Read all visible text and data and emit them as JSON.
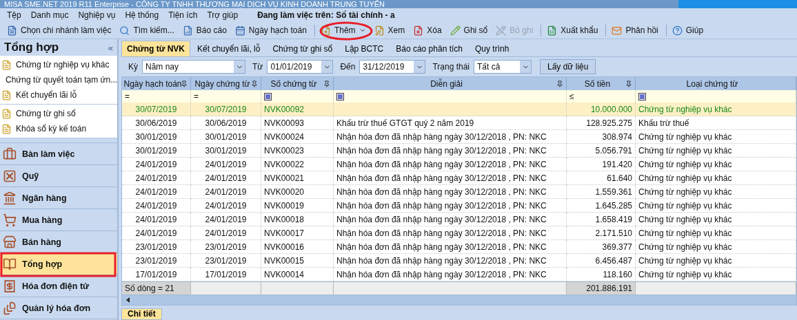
{
  "window": {
    "title": "MISA SME.NET 2019 R11 Enterprise - CÔNG TY TNHH THƯƠNG MẠI DỊCH VỤ KINH DOANH TRUNG TUYẾN"
  },
  "menu": {
    "items": [
      "Tệp",
      "Danh mục",
      "Nghiệp vụ",
      "Hệ thống",
      "Tiện ích",
      "Trợ giúp"
    ],
    "status": "Đang làm việc trên: Sổ tài chính - a"
  },
  "toolbar": [
    {
      "label": "Chọn chi nhánh làm việc",
      "disabled": false,
      "dropdown": false,
      "separator_before": false
    },
    {
      "label": "Tìm kiếm...",
      "disabled": false,
      "dropdown": false,
      "separator_before": false
    },
    {
      "label": "Báo cáo",
      "disabled": false,
      "dropdown": false,
      "separator_before": false
    },
    {
      "label": "Ngày hạch toán",
      "disabled": false,
      "dropdown": false,
      "separator_before": false
    },
    {
      "label": "Thêm",
      "disabled": false,
      "dropdown": true,
      "separator_before": true
    },
    {
      "label": "Xem",
      "disabled": false,
      "dropdown": false,
      "separator_before": false
    },
    {
      "label": "Xóa",
      "disabled": false,
      "dropdown": false,
      "separator_before": false
    },
    {
      "label": "Ghi sổ",
      "disabled": false,
      "dropdown": false,
      "separator_before": false
    },
    {
      "label": "Bỏ ghi",
      "disabled": true,
      "dropdown": false,
      "separator_before": false
    },
    {
      "label": "Xuất khẩu",
      "disabled": false,
      "dropdown": false,
      "separator_before": true
    },
    {
      "label": "Phản hồi",
      "disabled": false,
      "dropdown": false,
      "separator_before": true
    },
    {
      "label": "Giúp",
      "disabled": false,
      "dropdown": false,
      "separator_before": true
    }
  ],
  "sidebar": {
    "title": "Tổng hợp",
    "collapse": "«",
    "groups": [
      {
        "items": [
          "Chứng từ nghiệp vụ khác",
          "Chứng từ quyết toán tạm ứn...",
          "Kết chuyển lãi lỗ"
        ]
      },
      {
        "items": [
          "Chứng từ ghi sổ",
          "Khóa sổ kỳ kế toán"
        ]
      }
    ],
    "modules": [
      {
        "label": "Bàn làm việc",
        "selected": false
      },
      {
        "label": "Quỹ",
        "selected": false
      },
      {
        "label": "Ngân hàng",
        "selected": false
      },
      {
        "label": "Mua hàng",
        "selected": false
      },
      {
        "label": "Bán hàng",
        "selected": false
      },
      {
        "label": "Tổng hợp",
        "selected": true
      },
      {
        "label": "Hóa đơn điện tử",
        "selected": false
      },
      {
        "label": "Quản lý hóa đơn",
        "selected": false
      }
    ]
  },
  "tabs": [
    {
      "label": "Chứng từ NVK",
      "selected": true
    },
    {
      "label": "Kết chuyển lãi, lỗ",
      "selected": false
    },
    {
      "label": "Chứng từ ghi sổ",
      "selected": false
    },
    {
      "label": "Lập BCTC",
      "selected": false
    },
    {
      "label": "Báo cáo phân tích",
      "selected": false
    },
    {
      "label": "Quy trình",
      "selected": false
    }
  ],
  "filters": {
    "period_label": "Kỳ",
    "period": "Năm nay",
    "from_label": "Từ",
    "from": "01/01/2019",
    "to_label": "Đến",
    "to": "31/12/2019",
    "status_label": "Trạng thái",
    "status": "Tất cả",
    "fetch_button": "Lấy dữ liệu"
  },
  "table": {
    "columns": [
      {
        "label": "Ngày hạch toán",
        "pinned": true,
        "filter": {
          "kind": "operator",
          "text": "="
        }
      },
      {
        "label": "Ngày chứng từ",
        "pinned": true,
        "filter": {
          "kind": "operator",
          "text": "="
        }
      },
      {
        "label": "Số chứng từ",
        "pinned": true,
        "filter": {
          "kind": "checkbox"
        }
      },
      {
        "label": "Diễn giải",
        "pinned": true,
        "filter": {
          "kind": "checkbox"
        }
      },
      {
        "label": "Số tiền",
        "pinned": true,
        "filter": {
          "kind": "operator",
          "text": "≤"
        }
      },
      {
        "label": "Loại chứng từ",
        "pinned": false,
        "filter": {
          "kind": "checkbox"
        }
      }
    ],
    "rows": [
      {
        "selected": true,
        "cells": [
          "30/07/2019",
          "30/07/2019",
          "NVK00092",
          "",
          "10.000.000",
          "Chứng từ nghiệp vụ khác"
        ]
      },
      {
        "selected": false,
        "cells": [
          "30/06/2019",
          "30/06/2019",
          "NVK00093",
          "Khấu trừ thuế GTGT quý 2 năm 2019",
          "128.925.275",
          "Khấu trừ thuế"
        ]
      },
      {
        "selected": false,
        "cells": [
          "30/01/2019",
          "30/01/2019",
          "NVK00024",
          "Nhận hóa đơn đã nhập hàng ngày 30/12/2018 , PN: NKC",
          "308.974",
          "Chứng từ nghiệp vụ khác"
        ]
      },
      {
        "selected": false,
        "cells": [
          "30/01/2019",
          "30/01/2019",
          "NVK00023",
          "Nhận hóa đơn đã nhập hàng ngày 30/12/2018 , PN: NKC",
          "5.056.791",
          "Chứng từ nghiệp vụ khác"
        ]
      },
      {
        "selected": false,
        "cells": [
          "24/01/2019",
          "24/01/2019",
          "NVK00022",
          "Nhận hóa đơn đã nhập hàng ngày 30/12/2018 , PN: NKC",
          "191.420",
          "Chứng từ nghiệp vụ khác"
        ]
      },
      {
        "selected": false,
        "cells": [
          "24/01/2019",
          "24/01/2019",
          "NVK00021",
          "Nhận hóa đơn đã nhập hàng ngày 30/12/2018 , PN: NKC",
          "61.640",
          "Chứng từ nghiệp vụ khác"
        ]
      },
      {
        "selected": false,
        "cells": [
          "24/01/2019",
          "24/01/2019",
          "NVK00020",
          "Nhận hóa đơn đã nhập hàng ngày 30/12/2018 , PN: NKC",
          "1.559.361",
          "Chứng từ nghiệp vụ khác"
        ]
      },
      {
        "selected": false,
        "cells": [
          "24/01/2019",
          "24/01/2019",
          "NVK00019",
          "Nhận hóa đơn đã nhập hàng ngày 30/12/2018 , PN: NKC",
          "1.645.285",
          "Chứng từ nghiệp vụ khác"
        ]
      },
      {
        "selected": false,
        "cells": [
          "24/01/2019",
          "24/01/2019",
          "NVK00018",
          "Nhận hóa đơn đã nhập hàng ngày 30/12/2018 , PN: NKC",
          "1.658.419",
          "Chứng từ nghiệp vụ khác"
        ]
      },
      {
        "selected": false,
        "cells": [
          "24/01/2019",
          "24/01/2019",
          "NVK00017",
          "Nhận hóa đơn đã nhập hàng ngày 30/12/2018 , PN: NKC",
          "2.171.510",
          "Chứng từ nghiệp vụ khác"
        ]
      },
      {
        "selected": false,
        "cells": [
          "23/01/2019",
          "23/01/2019",
          "NVK00016",
          "Nhận hóa đơn đã nhập hàng ngày 30/12/2018 , PN: NKC",
          "369.377",
          "Chứng từ nghiệp vụ khác"
        ]
      },
      {
        "selected": false,
        "cells": [
          "23/01/2019",
          "23/01/2019",
          "NVK00015",
          "Nhận hóa đơn đã nhập hàng ngày 30/12/2018 , PN: NKC",
          "6.456.487",
          "Chứng từ nghiệp vụ khác"
        ]
      },
      {
        "selected": false,
        "cells": [
          "17/01/2019",
          "17/01/2019",
          "NVK00014",
          "Nhận hóa đơn đã nhập hàng ngày 30/12/2018 , PN: NKC",
          "118.160",
          "Chứng từ nghiệp vụ khác"
        ]
      }
    ],
    "row_count": "Số dòng = 21",
    "total": "201.886.191"
  },
  "bottom_tab": "Chi tiết"
}
